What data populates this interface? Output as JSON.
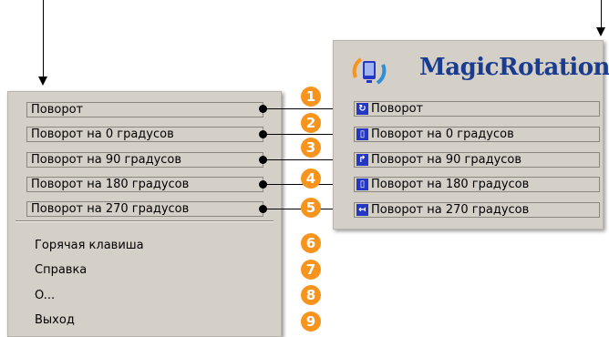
{
  "left_menu": {
    "boxed_items": [
      {
        "label": "Поворот"
      },
      {
        "label": "Поворот на 0 градусов"
      },
      {
        "label": "Поворот на 90 градусов"
      },
      {
        "label": "Поворот на 180 градусов"
      },
      {
        "label": "Поворот на 270 градусов"
      }
    ],
    "items": [
      {
        "label": "Горячая клавиша"
      },
      {
        "label": "Справка"
      },
      {
        "label": "O..."
      },
      {
        "label": "Выход"
      }
    ]
  },
  "badges": [
    "1",
    "2",
    "3",
    "4",
    "5",
    "6",
    "7",
    "8",
    "9"
  ],
  "right_panel": {
    "title": "MagicRotation",
    "items": [
      {
        "label": "Поворот",
        "icon": "rotate-icon"
      },
      {
        "label": "Поворот на 0 градусов",
        "icon": "rotate-0-icon"
      },
      {
        "label": "Поворот на 90 градусов",
        "icon": "rotate-90-icon"
      },
      {
        "label": "Поворот на 180 градусов",
        "icon": "rotate-180-icon"
      },
      {
        "label": "Поворот на 270 градусов",
        "icon": "rotate-270-icon"
      }
    ]
  },
  "colors": {
    "menu_bg": "#d4d0c8",
    "badge": "#f7941e",
    "title": "#1a3c8f",
    "icon": "#2437c4"
  }
}
